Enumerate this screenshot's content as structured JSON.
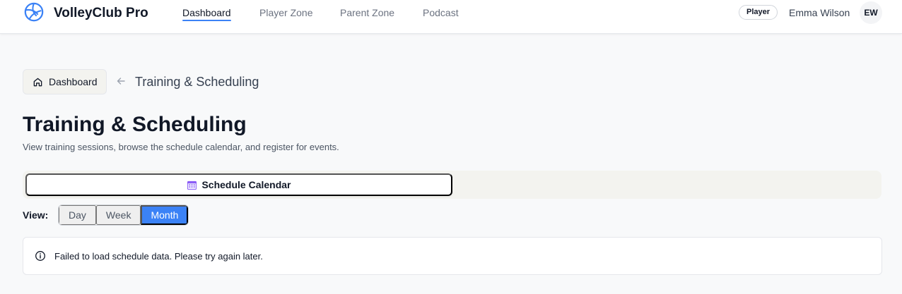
{
  "app": {
    "name": "VolleyClub Pro"
  },
  "nav": {
    "items": [
      {
        "label": "Dashboard",
        "active": true
      },
      {
        "label": "Player Zone",
        "active": false
      },
      {
        "label": "Parent Zone",
        "active": false
      },
      {
        "label": "Podcast",
        "active": false
      }
    ]
  },
  "user": {
    "role": "Player",
    "name": "Emma Wilson",
    "initials": "EW"
  },
  "breadcrumb": {
    "home_label": "Dashboard",
    "home_icon": "home-icon",
    "back_icon": "arrow-left-icon",
    "current": "Training & Scheduling"
  },
  "page": {
    "title": "Training & Scheduling",
    "subtitle": "View training sessions, browse the schedule calendar, and register for events."
  },
  "tabs": [
    {
      "label": "Schedule Calendar",
      "icon": "calendar-icon",
      "active": true
    }
  ],
  "view": {
    "label": "View:",
    "options": [
      "Day",
      "Week",
      "Month"
    ],
    "selected": "Month"
  },
  "alert": {
    "icon": "info-icon",
    "message": "Failed to load schedule data. Please try again later."
  },
  "colors": {
    "accent": "#3b82f6",
    "background": "#f8f9fa"
  }
}
